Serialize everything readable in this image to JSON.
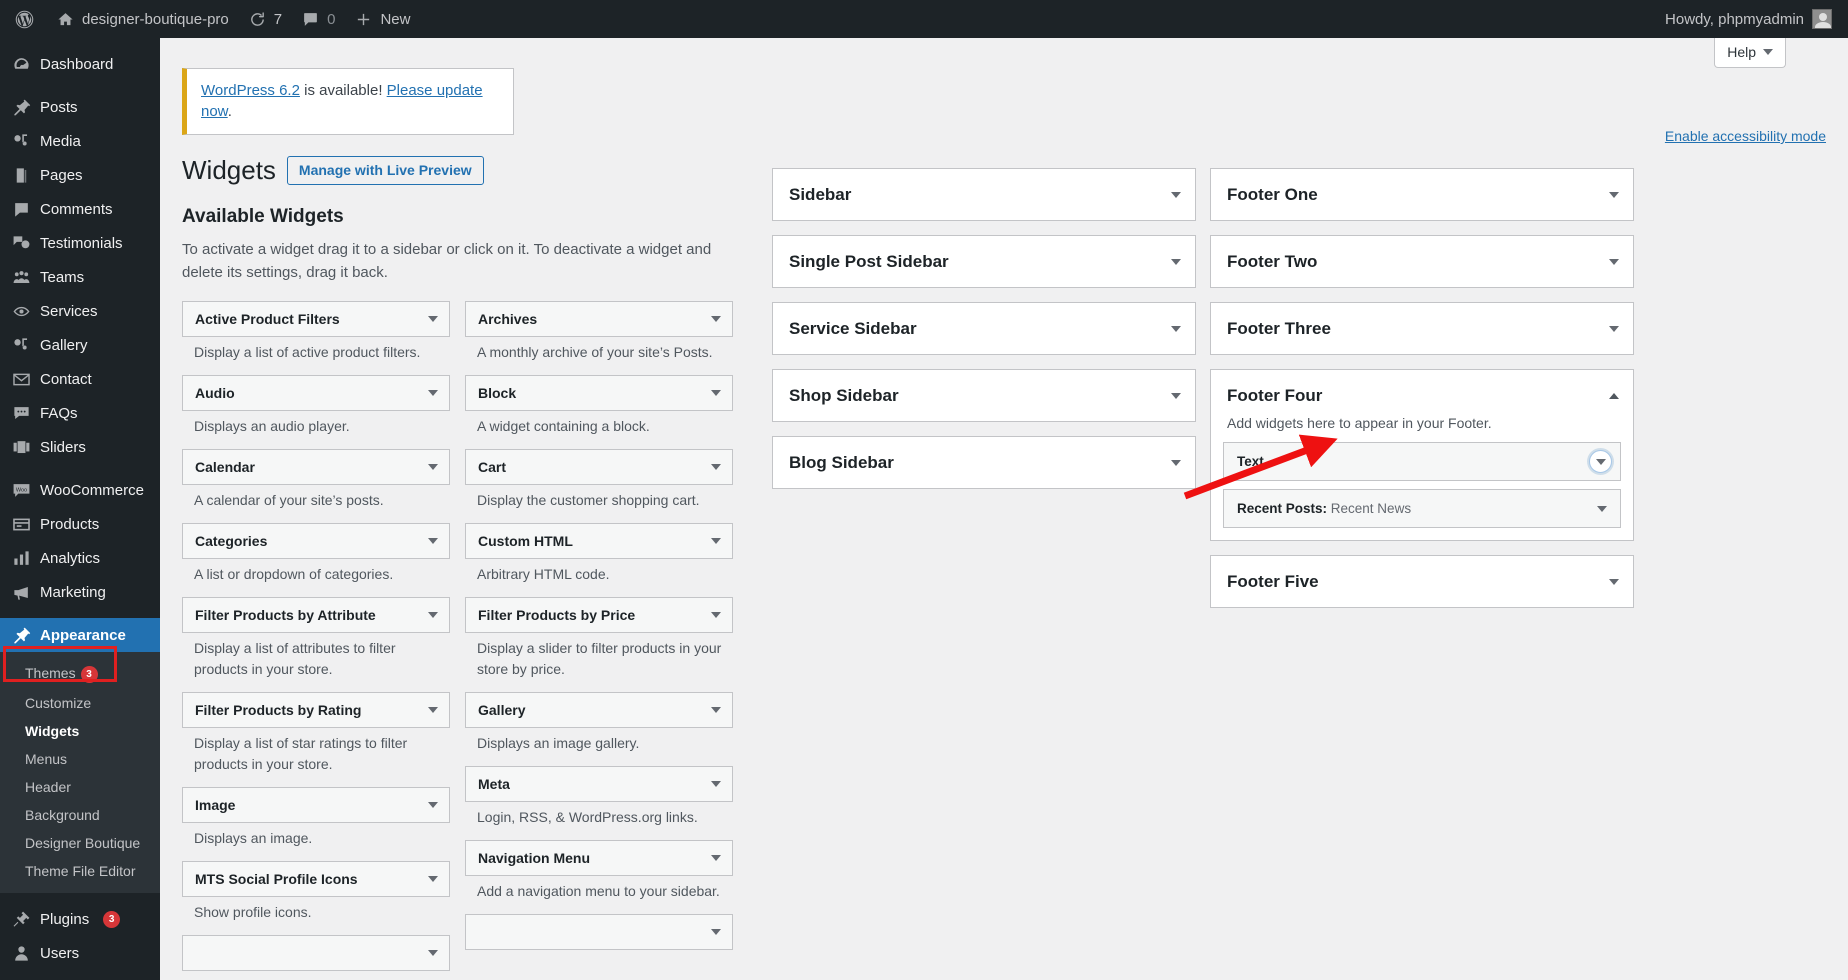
{
  "adminbar": {
    "logo_icon": "wordpress-logo-icon",
    "site_name": "designer-boutique-pro",
    "site_icon": "home-icon",
    "updates_icon": "update-icon",
    "updates_count": "7",
    "comments_icon": "comment-bubble-icon",
    "comments_count": "0",
    "new_icon": "plus-icon",
    "new_label": "New",
    "howdy": "Howdy, phpmyadmin",
    "avatar_icon": "avatar-icon"
  },
  "sidebar": {
    "items": [
      {
        "label": "Dashboard",
        "icon": "dashboard-icon"
      },
      {
        "label": "Posts",
        "icon": "pin-icon"
      },
      {
        "label": "Media",
        "icon": "media-icon"
      },
      {
        "label": "Pages",
        "icon": "pages-icon"
      },
      {
        "label": "Comments",
        "icon": "comments-icon"
      },
      {
        "label": "Testimonials",
        "icon": "testimonials-icon"
      },
      {
        "label": "Teams",
        "icon": "teams-icon"
      },
      {
        "label": "Services",
        "icon": "services-icon"
      },
      {
        "label": "Gallery",
        "icon": "gallery-icon"
      },
      {
        "label": "Contact",
        "icon": "envelope-icon"
      },
      {
        "label": "FAQs",
        "icon": "faq-icon"
      },
      {
        "label": "Sliders",
        "icon": "sliders-icon"
      },
      {
        "label": "WooCommerce",
        "icon": "woocommerce-icon"
      },
      {
        "label": "Products",
        "icon": "products-icon"
      },
      {
        "label": "Analytics",
        "icon": "analytics-icon"
      },
      {
        "label": "Marketing",
        "icon": "marketing-icon"
      },
      {
        "label": "Appearance",
        "icon": "appearance-icon",
        "current": true
      }
    ],
    "appearance_submenu": [
      {
        "label": "Themes",
        "badge": "3"
      },
      {
        "label": "Customize"
      },
      {
        "label": "Widgets",
        "current": true
      },
      {
        "label": "Menus"
      },
      {
        "label": "Header"
      },
      {
        "label": "Background"
      },
      {
        "label": "Designer Boutique"
      },
      {
        "label": "Theme File Editor"
      }
    ],
    "bottom_items": [
      {
        "label": "Plugins",
        "icon": "plugins-icon",
        "badge": "3"
      },
      {
        "label": "Users",
        "icon": "users-icon"
      }
    ]
  },
  "header": {
    "help_label": "Help",
    "help_icon": "chevron-down-icon",
    "update_notice_prefix": "WordPress 6.2",
    "update_notice_middle": " is available! ",
    "update_notice_link": "Please update now",
    "update_notice_suffix": ".",
    "page_title": "Widgets",
    "live_preview_label": "Manage with Live Preview",
    "accessibility_link": "Enable accessibility mode"
  },
  "available": {
    "heading": "Available Widgets",
    "description": "To activate a widget drag it to a sidebar or click on it. To deactivate a widget and delete its settings, drag it back.",
    "column_left": [
      {
        "title": "Active Product Filters",
        "desc": "Display a list of active product filters.",
        "icon": "chevron-down-icon"
      },
      {
        "title": "Audio",
        "desc": "Displays an audio player.",
        "icon": "chevron-down-icon"
      },
      {
        "title": "Calendar",
        "desc": "A calendar of your site’s posts.",
        "icon": "chevron-down-icon"
      },
      {
        "title": "Categories",
        "desc": "A list or dropdown of categories.",
        "icon": "chevron-down-icon"
      },
      {
        "title": "Filter Products by Attribute",
        "desc": "Display a list of attributes to filter products in your store.",
        "icon": "chevron-down-icon"
      },
      {
        "title": "Filter Products by Rating",
        "desc": "Display a list of star ratings to filter products in your store.",
        "icon": "chevron-down-icon"
      },
      {
        "title": "Image",
        "desc": "Displays an image.",
        "icon": "chevron-down-icon"
      },
      {
        "title": "MTS Social Profile Icons",
        "desc": "Show profile icons.",
        "icon": "chevron-down-icon"
      }
    ],
    "column_right": [
      {
        "title": "Archives",
        "desc": "A monthly archive of your site’s Posts.",
        "icon": "chevron-down-icon"
      },
      {
        "title": "Block",
        "desc": "A widget containing a block.",
        "icon": "chevron-down-icon"
      },
      {
        "title": "Cart",
        "desc": "Display the customer shopping cart.",
        "icon": "chevron-down-icon"
      },
      {
        "title": "Custom HTML",
        "desc": "Arbitrary HTML code.",
        "icon": "chevron-down-icon"
      },
      {
        "title": "Filter Products by Price",
        "desc": "Display a slider to filter products in your store by price.",
        "icon": "chevron-down-icon"
      },
      {
        "title": "Gallery",
        "desc": "Displays an image gallery.",
        "icon": "chevron-down-icon"
      },
      {
        "title": "Meta",
        "desc": "Login, RSS, & WordPress.org links.",
        "icon": "chevron-down-icon"
      },
      {
        "title": "Navigation Menu",
        "desc": "Add a navigation menu to your sidebar.",
        "icon": "chevron-down-icon"
      }
    ]
  },
  "sidebars_mid": [
    {
      "name": "Sidebar",
      "icon": "chevron-down-icon"
    },
    {
      "name": "Single Post Sidebar",
      "icon": "chevron-down-icon"
    },
    {
      "name": "Service Sidebar",
      "icon": "chevron-down-icon"
    },
    {
      "name": "Shop Sidebar",
      "icon": "chevron-down-icon"
    },
    {
      "name": "Blog Sidebar",
      "icon": "chevron-down-icon"
    }
  ],
  "sidebars_right": [
    {
      "name": "Footer One",
      "icon": "chevron-down-icon"
    },
    {
      "name": "Footer Two",
      "icon": "chevron-down-icon"
    },
    {
      "name": "Footer Three",
      "icon": "chevron-down-icon"
    }
  ],
  "footer_four": {
    "name": "Footer Four",
    "icon": "chevron-up-icon",
    "description": "Add widgets here to appear in your Footer.",
    "widgets": [
      {
        "title": "Text",
        "subtitle": "",
        "icon": "chevron-down-icon",
        "focused": true
      },
      {
        "title": "Recent Posts:",
        "subtitle": " Recent News",
        "icon": "chevron-down-icon",
        "focused": false
      }
    ]
  },
  "footer_five": {
    "name": "Footer Five",
    "icon": "chevron-down-icon"
  },
  "annotation": {
    "arrow_color": "#ee1111",
    "highlight_color": "#e02020"
  }
}
